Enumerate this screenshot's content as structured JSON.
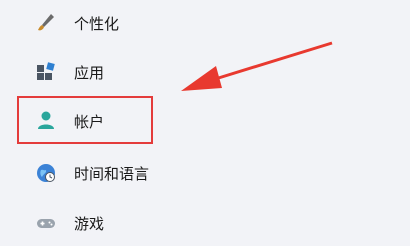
{
  "nav": {
    "items": [
      {
        "label": "个性化",
        "icon": "brush-icon"
      },
      {
        "label": "应用",
        "icon": "apps-icon"
      },
      {
        "label": "帐户",
        "icon": "account-icon"
      },
      {
        "label": "时间和语言",
        "icon": "globe-clock-icon"
      },
      {
        "label": "游戏",
        "icon": "gamepad-icon"
      }
    ]
  },
  "colors": {
    "background": "#f2f3f7",
    "highlight_border": "#e43b3b",
    "arrow": "#e8392f",
    "account_icon": "#2aa69c"
  }
}
